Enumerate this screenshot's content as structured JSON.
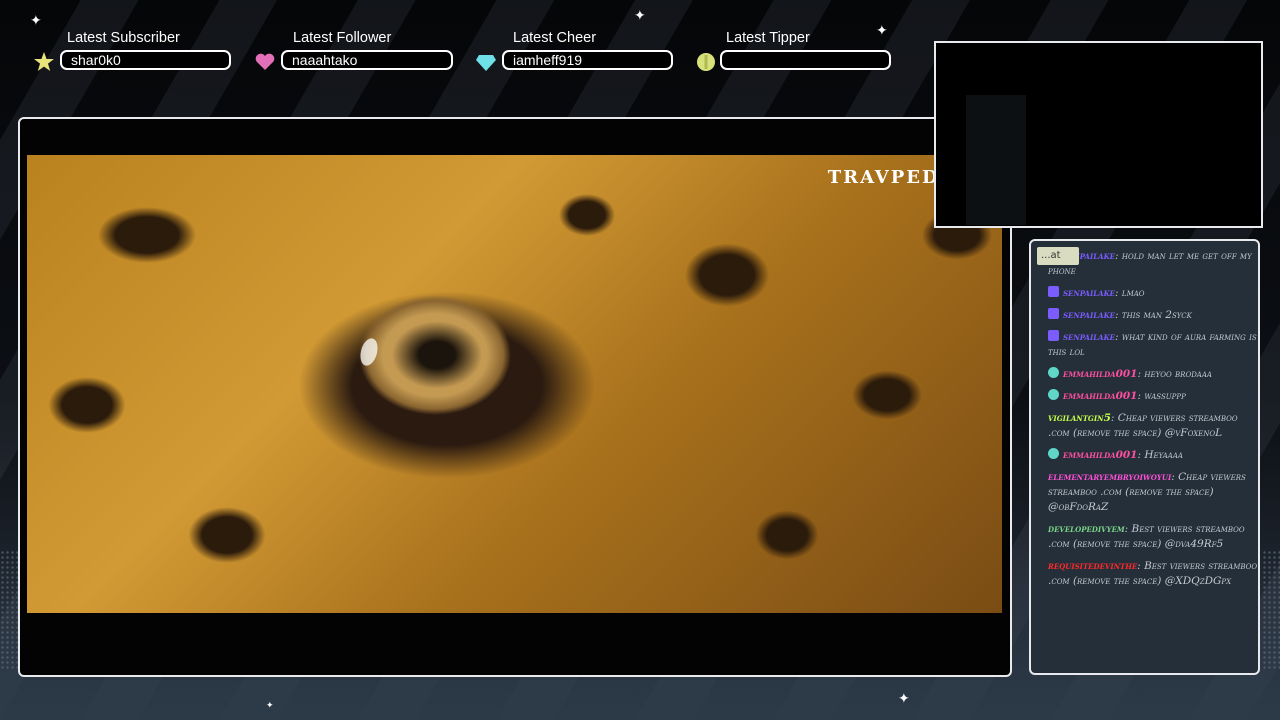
{
  "labels": [
    {
      "title": "Latest Subscriber",
      "value": "shar0k0",
      "icon": "star-icon",
      "color": "#e8e27a"
    },
    {
      "title": "Latest Follower",
      "value": "naaahtako",
      "icon": "heart-icon",
      "color": "#e36fb8"
    },
    {
      "title": "Latest Cheer",
      "value": "iamheff919",
      "icon": "diamond-icon",
      "color": "#6fe0e8"
    },
    {
      "title": "Latest Tipper",
      "value": "",
      "icon": "coin-icon",
      "color": "#d8e27a"
    }
  ],
  "video": {
    "watermark": "TRAVPEDIA"
  },
  "chat": {
    "tab_label": "...at",
    "messages": [
      {
        "user": "senpailake",
        "text": "hold man let me get off my phone",
        "user_color": "#7a5cff",
        "badge": "twitch-icon"
      },
      {
        "user": "senpailake",
        "text": "lmao",
        "user_color": "#7a5cff",
        "badge": "twitch-icon"
      },
      {
        "user": "senpailake",
        "text": "this man 2syck",
        "user_color": "#7a5cff",
        "badge": "twitch-icon"
      },
      {
        "user": "senpailake",
        "text": "what kind of aura farming is this lol",
        "user_color": "#7a5cff",
        "badge": "twitch-icon"
      },
      {
        "user": "emmahilda001",
        "text": "heyoo brodaaa",
        "user_color": "#ff4fa0",
        "badge": "gem-icon"
      },
      {
        "user": "emmahilda001",
        "text": "wassuppp",
        "user_color": "#ff4fa0",
        "badge": "gem-icon"
      },
      {
        "user": "vigilantgin5",
        "text": "Cheap viewers streamboo .com (remove the space) @vFoxenoL",
        "user_color": "#c8ff4a",
        "badge": ""
      },
      {
        "user": "emmahilda001",
        "text": "Heyaaaa",
        "user_color": "#ff4fa0",
        "badge": "gem-icon"
      },
      {
        "user": "elementaryembryoiwoyui",
        "text": "Cheap viewers streamboo .com (remove the space) @obFdoRaZ",
        "user_color": "#ff4fd8",
        "badge": ""
      },
      {
        "user": "developedivyem",
        "text": "Best viewers streamboo .com (remove the space) @dva49Rf5",
        "user_color": "#7bd48a",
        "badge": ""
      },
      {
        "user": "requisitedevinthe",
        "text": "Best viewers streamboo .com (remove the space) @XDQzDGpx",
        "user_color": "#ff2a2a",
        "badge": ""
      }
    ]
  }
}
